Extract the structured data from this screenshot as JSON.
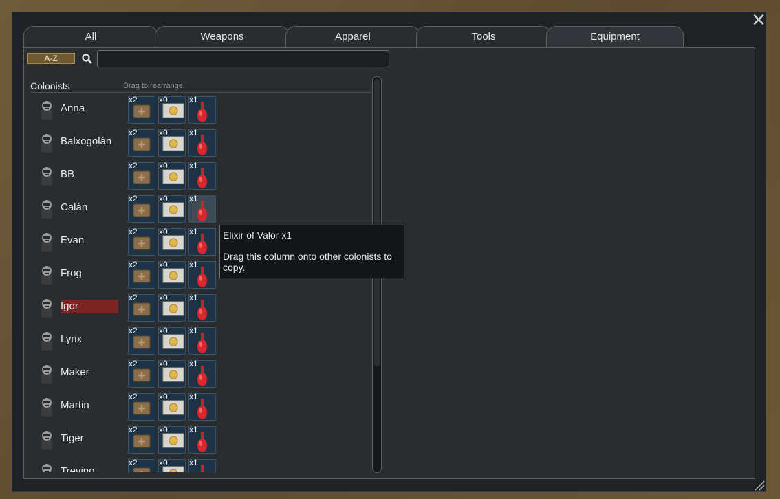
{
  "window": {
    "close_icon": "close-icon"
  },
  "tabs": [
    {
      "label": "All"
    },
    {
      "label": "Weapons"
    },
    {
      "label": "Apparel"
    },
    {
      "label": "Tools"
    },
    {
      "label": "Equipment",
      "active": true
    }
  ],
  "toolbar": {
    "sort_label": "A-Z",
    "search_placeholder": "",
    "search_value": ""
  },
  "list": {
    "header": "Colonists",
    "drag_hint": "Drag to rearrange."
  },
  "slot_items": [
    "medkit-icon",
    "coin-icon",
    "potion-icon"
  ],
  "colonists": [
    {
      "name": "Anna",
      "counts": [
        "x2",
        "x0",
        "x1"
      ]
    },
    {
      "name": "Balxogolán",
      "counts": [
        "x2",
        "x0",
        "x1"
      ]
    },
    {
      "name": "BB",
      "counts": [
        "x2",
        "x0",
        "x1"
      ]
    },
    {
      "name": "Calán",
      "counts": [
        "x2",
        "x0",
        "x1"
      ]
    },
    {
      "name": "Evan",
      "counts": [
        "x2",
        "x0",
        "x1"
      ]
    },
    {
      "name": "Frog",
      "counts": [
        "x2",
        "x0",
        "x1"
      ]
    },
    {
      "name": "Igor",
      "counts": [
        "x2",
        "x0",
        "x1"
      ],
      "selected": true
    },
    {
      "name": "Lynx",
      "counts": [
        "x2",
        "x0",
        "x1"
      ]
    },
    {
      "name": "Maker",
      "counts": [
        "x2",
        "x0",
        "x1"
      ]
    },
    {
      "name": "Martin",
      "counts": [
        "x2",
        "x0",
        "x1"
      ]
    },
    {
      "name": "Tiger",
      "counts": [
        "x2",
        "x0",
        "x1"
      ]
    },
    {
      "name": "Trevino",
      "counts": [
        "x2",
        "x0",
        "x1"
      ]
    }
  ],
  "tooltip": {
    "title": "Elixir of Valor x1",
    "body": "Drag this column onto other colonists to copy."
  },
  "colors": {
    "selected_row": "#7a2424",
    "slot_bg": "#1e3346",
    "sort_button": "#6e5a32"
  }
}
